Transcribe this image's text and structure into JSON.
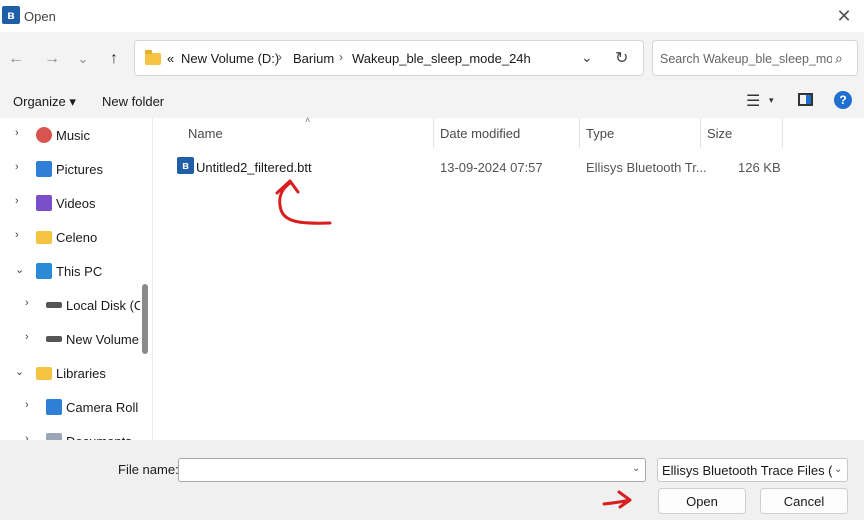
{
  "window": {
    "title": "Open",
    "app_icon": "bluetooth-icon",
    "close_glyph": "✕"
  },
  "nav": {
    "back_glyph": "←",
    "forward_glyph": "→",
    "recent_glyph": "⌄",
    "up_glyph": "↑",
    "breadcrumb_prefix": "«",
    "breadcrumb": [
      "New Volume (D:)",
      "Barium",
      "Wakeup_ble_sleep_mode_24h"
    ],
    "sep": "›",
    "dropdown_glyph": "⌄",
    "refresh_glyph": "↻",
    "search_placeholder": "Search Wakeup_ble_sleep_mo...",
    "search_glyph": "⌕"
  },
  "command_bar": {
    "organize": "Organize ▾",
    "new_folder": "New folder",
    "view_glyph": "☰",
    "view_caret": "▾",
    "help_glyph": "?"
  },
  "nav_pane": [
    {
      "label": "Music",
      "chevron": "›",
      "icon": "music-icon",
      "color": "#d9534f"
    },
    {
      "label": "Pictures",
      "chevron": "›",
      "icon": "pictures-icon",
      "color": "#2f7fd6"
    },
    {
      "label": "Videos",
      "chevron": "›",
      "icon": "videos-icon",
      "color": "#7b4fc9"
    },
    {
      "label": "Celeno",
      "chevron": "›",
      "icon": "folder-icon",
      "color": "#f5c342"
    },
    {
      "label": "This PC",
      "chevron": "⌄",
      "icon": "computer-icon",
      "color": "#2b8ad6"
    },
    {
      "label": "Local Disk (C:",
      "chevron": "›",
      "icon": "drive-icon",
      "color": "#555555"
    },
    {
      "label": "New Volume",
      "chevron": "›",
      "icon": "drive-icon",
      "color": "#555555"
    },
    {
      "label": "Libraries",
      "chevron": "⌄",
      "icon": "folder-icon",
      "color": "#f5c342"
    },
    {
      "label": "Camera Roll",
      "chevron": "›",
      "icon": "pictures-icon",
      "color": "#2f7fd6"
    },
    {
      "label": "Documents",
      "chevron": "›",
      "icon": "documents-icon",
      "color": "#9aa6b8"
    }
  ],
  "columns": {
    "name": "Name",
    "date": "Date modified",
    "type": "Type",
    "size": "Size",
    "sort_glyph": "˄"
  },
  "files": [
    {
      "name": "Untitled2_filtered.btt",
      "date": "13-09-2024 07:57",
      "type": "Ellisys Bluetooth Tr...",
      "size": "126 KB",
      "icon": "bluetooth-file-icon"
    }
  ],
  "footer": {
    "file_name_label": "File name:",
    "file_name_value": "",
    "file_name_drop": "⌄",
    "file_type": "Ellisys Bluetooth Trace Files (*.btt)",
    "file_type_caret": "⌄",
    "open": "Open",
    "cancel": "Cancel"
  },
  "annotation_color": "#d81e1e"
}
